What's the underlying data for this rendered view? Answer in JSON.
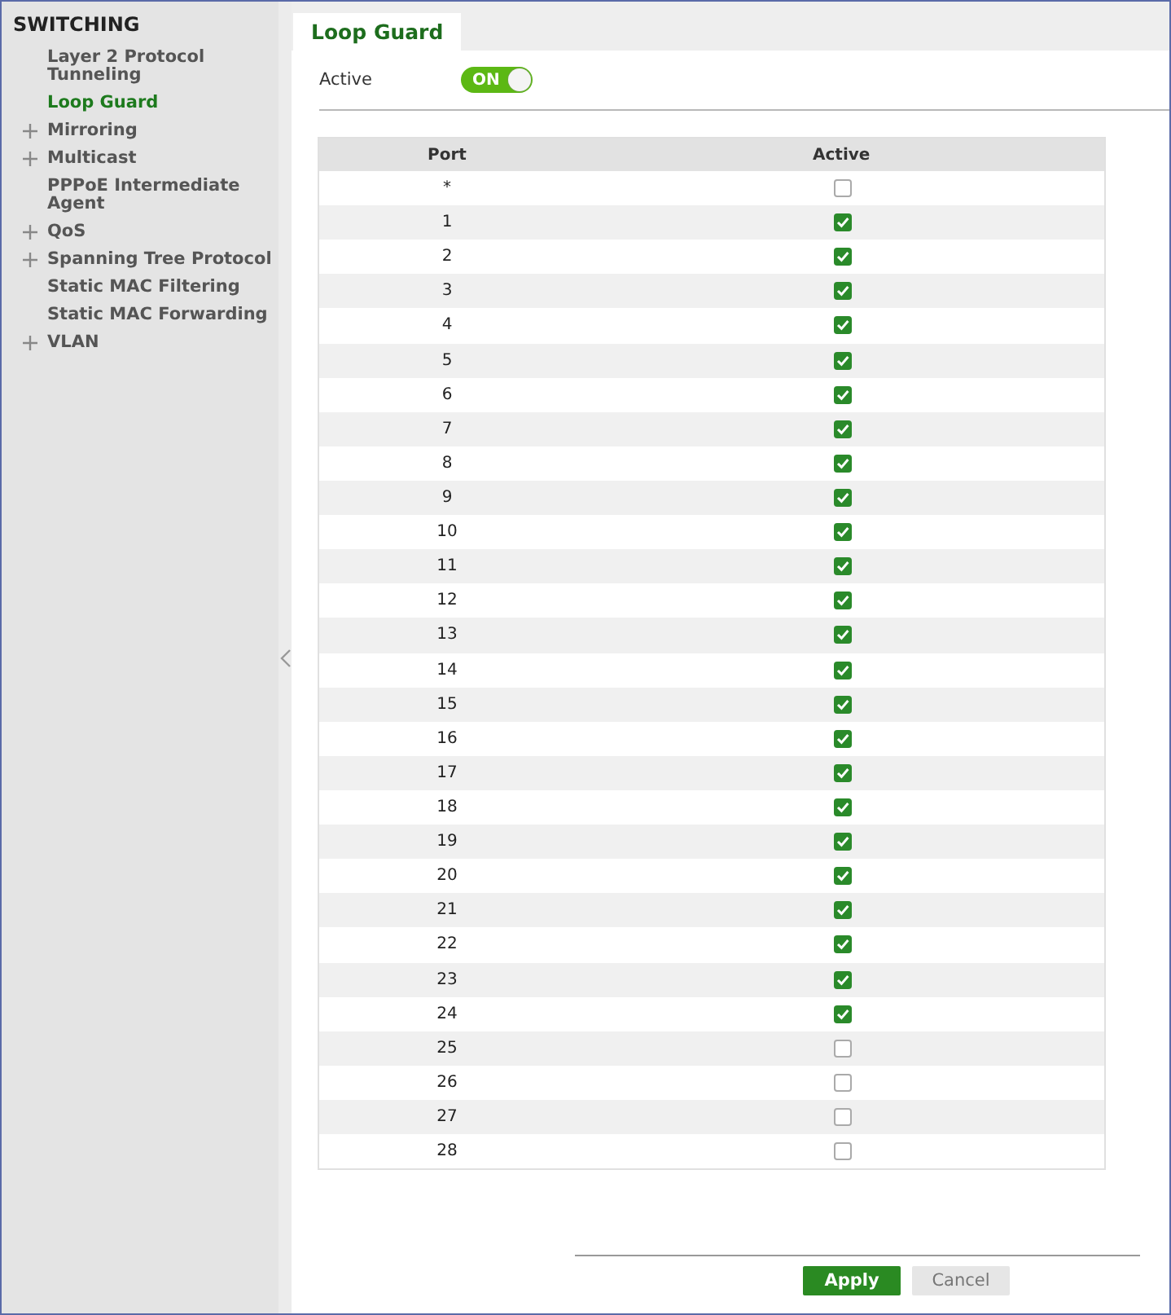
{
  "sidebar": {
    "title": "SWITCHING",
    "items": [
      {
        "label": "Layer 2 Protocol Tunneling",
        "expandable": false,
        "selected": false
      },
      {
        "label": "Loop Guard",
        "expandable": false,
        "selected": true
      },
      {
        "label": "Mirroring",
        "expandable": true,
        "selected": false
      },
      {
        "label": "Multicast",
        "expandable": true,
        "selected": false
      },
      {
        "label": "PPPoE Intermediate Agent",
        "expandable": false,
        "selected": false
      },
      {
        "label": "QoS",
        "expandable": true,
        "selected": false
      },
      {
        "label": "Spanning Tree Protocol",
        "expandable": true,
        "selected": false
      },
      {
        "label": "Static MAC Filtering",
        "expandable": false,
        "selected": false
      },
      {
        "label": "Static MAC Forwarding",
        "expandable": false,
        "selected": false
      },
      {
        "label": "VLAN",
        "expandable": true,
        "selected": false
      }
    ]
  },
  "tabs": [
    {
      "label": "Loop Guard",
      "selected": true
    }
  ],
  "active_setting": {
    "label": "Active",
    "toggle_text": "ON",
    "on": true
  },
  "table": {
    "columns": [
      "Port",
      "Active"
    ],
    "rows": [
      {
        "port": "*",
        "checked": false
      },
      {
        "port": "1",
        "checked": true
      },
      {
        "port": "2",
        "checked": true
      },
      {
        "port": "3",
        "checked": true
      },
      {
        "port": "4",
        "checked": true
      },
      {
        "port": "5",
        "checked": true
      },
      {
        "port": "6",
        "checked": true
      },
      {
        "port": "7",
        "checked": true
      },
      {
        "port": "8",
        "checked": true
      },
      {
        "port": "9",
        "checked": true
      },
      {
        "port": "10",
        "checked": true
      },
      {
        "port": "11",
        "checked": true
      },
      {
        "port": "12",
        "checked": true
      },
      {
        "port": "13",
        "checked": true
      },
      {
        "port": "14",
        "checked": true
      },
      {
        "port": "15",
        "checked": true
      },
      {
        "port": "16",
        "checked": true
      },
      {
        "port": "17",
        "checked": true
      },
      {
        "port": "18",
        "checked": true
      },
      {
        "port": "19",
        "checked": true
      },
      {
        "port": "20",
        "checked": true
      },
      {
        "port": "21",
        "checked": true
      },
      {
        "port": "22",
        "checked": true
      },
      {
        "port": "23",
        "checked": true
      },
      {
        "port": "24",
        "checked": true
      },
      {
        "port": "25",
        "checked": false
      },
      {
        "port": "26",
        "checked": false
      },
      {
        "port": "27",
        "checked": false
      },
      {
        "port": "28",
        "checked": false
      }
    ]
  },
  "buttons": [
    {
      "label": "Apply",
      "kind": "primary"
    },
    {
      "label": "Cancel",
      "kind": "secondary"
    }
  ]
}
